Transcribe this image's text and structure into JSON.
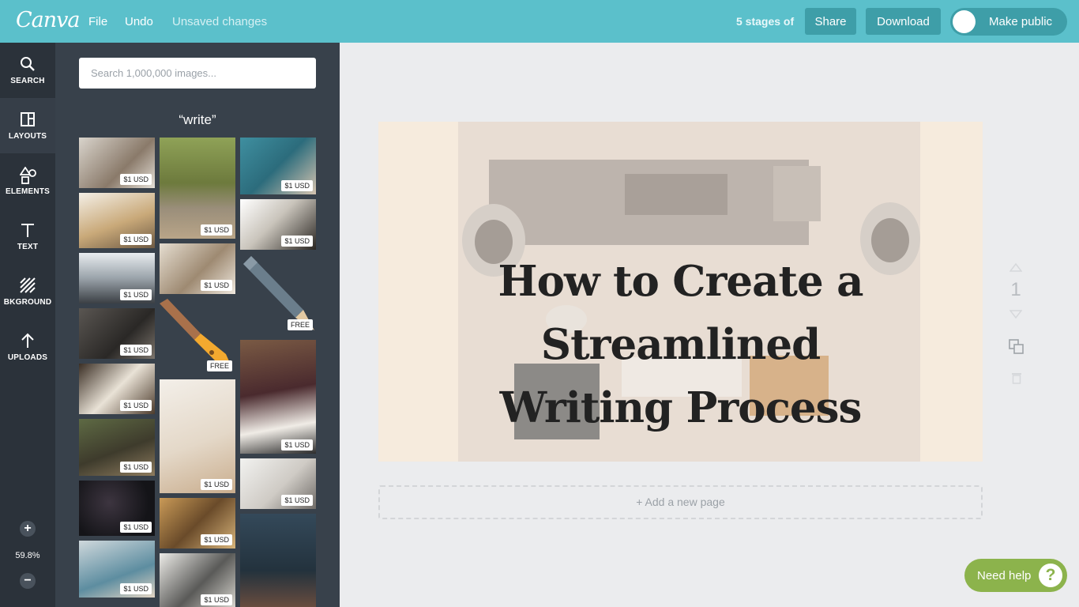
{
  "app": {
    "logo": "Canva",
    "menu": {
      "file": "File",
      "undo": "Undo",
      "unsaved": "Unsaved changes"
    },
    "title": "5 stages of",
    "share_label": "Share",
    "download_label": "Download",
    "public_label": "Make public",
    "accent_color": "#5bc0cb"
  },
  "nav": {
    "items": [
      {
        "label": "SEARCH",
        "icon": "search-icon"
      },
      {
        "label": "LAYOUTS",
        "icon": "layouts-icon"
      },
      {
        "label": "ELEMENTS",
        "icon": "elements-icon"
      },
      {
        "label": "TEXT",
        "icon": "text-icon"
      },
      {
        "label": "BKGROUND",
        "icon": "background-icon"
      },
      {
        "label": "UPLOADS",
        "icon": "upload-icon"
      }
    ],
    "zoom_plus": "+",
    "zoom_level": "59.8%",
    "zoom_minus": "−"
  },
  "panel": {
    "search_placeholder": "Search 1,000,000 images...",
    "query": "“write”",
    "price_label": "$1 USD",
    "free_label": "FREE"
  },
  "canvas": {
    "headline_line1": "How to Create a Streamlined",
    "headline_line2": "Writing Process",
    "add_page": "+ Add a new page",
    "page_number": "1"
  },
  "help": {
    "label": "Need help",
    "icon_text": "?"
  }
}
